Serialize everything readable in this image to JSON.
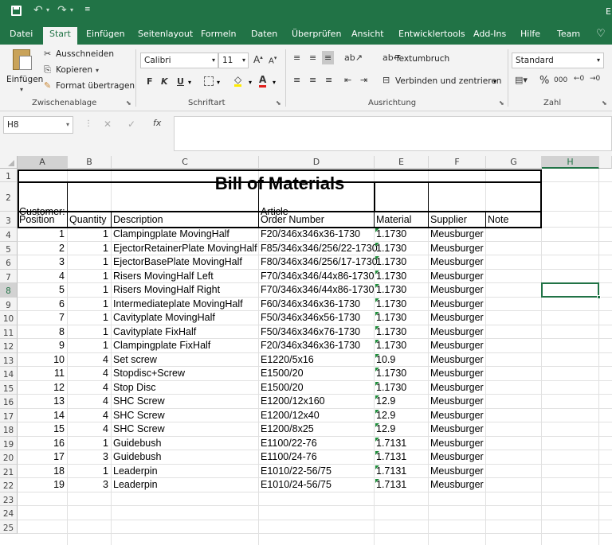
{
  "titlebar": {
    "quick_access": [
      "save-icon",
      "undo-icon",
      "redo-icon",
      "customize-icon"
    ],
    "right_fragment": "E"
  },
  "tabs": [
    "Datei",
    "Start",
    "Einfügen",
    "Seitenlayout",
    "Formeln",
    "Daten",
    "Überprüfen",
    "Ansicht",
    "Entwicklertools",
    "Add-Ins",
    "Hilfe",
    "Team"
  ],
  "ribbon": {
    "clipboard": {
      "paste": "Einfügen",
      "cut": "Ausschneiden",
      "copy": "Kopieren",
      "format_painter": "Format übertragen",
      "label": "Zwischenablage"
    },
    "font": {
      "name": "Calibri",
      "size": "11",
      "bold": "F",
      "italic": "K",
      "underline": "U",
      "label": "Schriftart"
    },
    "alignment": {
      "wrap": "Textumbruch",
      "merge": "Verbinden und zentrieren",
      "label": "Ausrichtung"
    },
    "number": {
      "format": "Standard",
      "percent": "%",
      "thousands": "000",
      "label": "Zahl"
    }
  },
  "formula_bar": {
    "name_box": "H8",
    "fx": "fx",
    "content": ""
  },
  "sheet": {
    "columns": [
      "A",
      "B",
      "C",
      "D",
      "E",
      "F",
      "G",
      "H"
    ],
    "row_numbers": [
      "1",
      "2",
      "3",
      "4",
      "5",
      "6",
      "7",
      "8",
      "9",
      "10",
      "11",
      "12",
      "13",
      "14",
      "15",
      "16",
      "17",
      "18",
      "19",
      "20",
      "21",
      "22",
      "23",
      "24",
      "25"
    ],
    "title": "Bill of Materials",
    "customer_label": "Customer:",
    "article_label": "Article",
    "headers": [
      "Position",
      "Quantity",
      "Description",
      "Order Number",
      "Material",
      "Supplier",
      "Note"
    ],
    "rows": [
      [
        "1",
        "1",
        "Clampingplate MovingHalf",
        "F20/346x346x36-1730",
        "1.1730",
        "Meusburger"
      ],
      [
        "2",
        "1",
        "EjectorRetainerPlate MovingHalf",
        "F85/346x346/256/22-1730",
        "1.1730",
        "Meusburger"
      ],
      [
        "3",
        "1",
        "EjectorBasePlate MovingHalf",
        "F80/346x346/256/17-1730",
        "1.1730",
        "Meusburger"
      ],
      [
        "4",
        "1",
        "Risers MovingHalf Left",
        "F70/346x346/44x86-1730",
        "1.1730",
        "Meusburger"
      ],
      [
        "5",
        "1",
        "Risers MovingHalf Right",
        "F70/346x346/44x86-1730",
        "1.1730",
        "Meusburger"
      ],
      [
        "6",
        "1",
        "Intermediateplate MovingHalf",
        "F60/346x346x36-1730",
        "1.1730",
        "Meusburger"
      ],
      [
        "7",
        "1",
        "Cavityplate MovingHalf",
        "F50/346x346x56-1730",
        "1.1730",
        "Meusburger"
      ],
      [
        "8",
        "1",
        "Cavityplate FixHalf",
        "F50/346x346x76-1730",
        "1.1730",
        "Meusburger"
      ],
      [
        "9",
        "1",
        "Clampingplate FixHalf",
        "F20/346x346x36-1730",
        "1.1730",
        "Meusburger"
      ],
      [
        "10",
        "4",
        "Set screw",
        "E1220/5x16",
        "10.9",
        "Meusburger"
      ],
      [
        "11",
        "4",
        "Stopdisc+Screw",
        "E1500/20",
        "1.1730",
        "Meusburger"
      ],
      [
        "12",
        "4",
        "Stop Disc",
        "E1500/20",
        "1.1730",
        "Meusburger"
      ],
      [
        "13",
        "4",
        "SHC Screw",
        "E1200/12x160",
        "12.9",
        "Meusburger"
      ],
      [
        "14",
        "4",
        "SHC Screw",
        "E1200/12x40",
        "12.9",
        "Meusburger"
      ],
      [
        "15",
        "4",
        "SHC Screw",
        "E1200/8x25",
        "12.9",
        "Meusburger"
      ],
      [
        "16",
        "1",
        "Guidebush",
        "E1100/22-76",
        "1.7131",
        "Meusburger"
      ],
      [
        "17",
        "3",
        "Guidebush",
        "E1100/24-76",
        "1.7131",
        "Meusburger"
      ],
      [
        "18",
        "1",
        "Leaderpin",
        "E1010/22-56/75",
        "1.7131",
        "Meusburger"
      ],
      [
        "19",
        "3",
        "Leaderpin",
        "E1010/24-56/75",
        "1.7131",
        "Meusburger"
      ]
    ]
  }
}
